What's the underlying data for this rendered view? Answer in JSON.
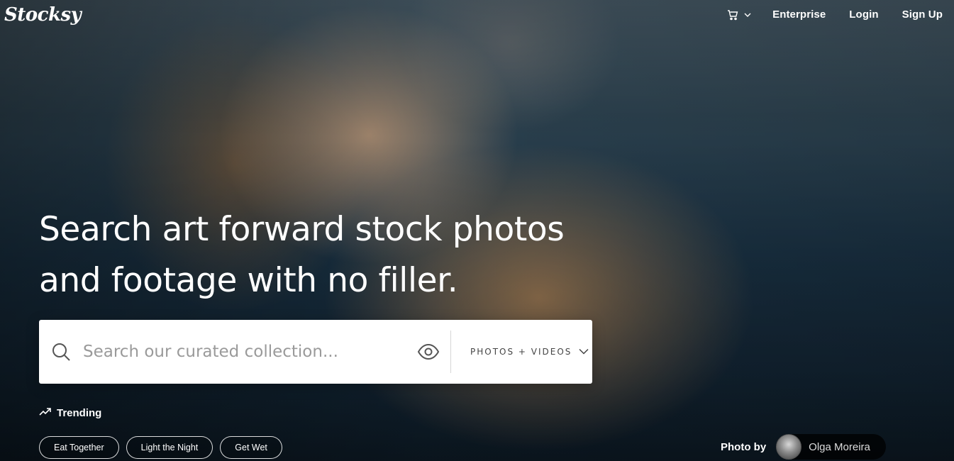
{
  "nav": {
    "logo": "Stocksy",
    "cart_icon": "cart-icon",
    "links": [
      "Enterprise",
      "Login",
      "Sign Up"
    ]
  },
  "hero": {
    "headline_line1": "Search art forward stock photos",
    "headline_line2": "and footage with no filler."
  },
  "search": {
    "placeholder": "Search our curated collection...",
    "value": "",
    "type_selected": "PHOTOS + VIDEOS"
  },
  "trending": {
    "label": "Trending",
    "chips": [
      "Eat Together",
      "Light the Night",
      "Get Wet"
    ]
  },
  "credit": {
    "label": "Photo by",
    "name": "Olga Moreira"
  },
  "colors": {
    "search_bg": "#ffffff",
    "text_light": "#ffffff",
    "placeholder": "#9a9a9a"
  }
}
